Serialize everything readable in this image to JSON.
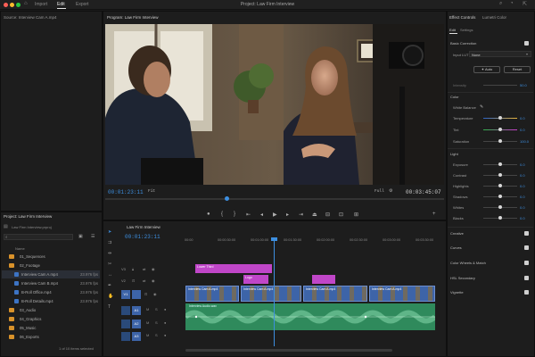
{
  "titlebar": {
    "tabs": [
      "Import",
      "Edit",
      "Export"
    ],
    "active_tab": "Edit",
    "project_title": "Project: Law Firm Interview"
  },
  "source_monitor": {
    "title": "Source: Interview Cam A.mp4"
  },
  "program_monitor": {
    "title": "Program: Law Firm Interview",
    "timecode": "00:01:23:11",
    "fit": "Fit",
    "quality": "Full",
    "duration": "00:03:45:07"
  },
  "effect_controls": {
    "tabs": [
      "Effect Controls",
      "Lumetri Color"
    ],
    "subtabs": [
      "Edit",
      "Settings"
    ],
    "basic_correction": "Basic Correction",
    "input_lut_label": "Input LUT",
    "input_lut_value": "None",
    "auto": "Auto",
    "reset": "Reset",
    "intensity_label": "Intensity",
    "intensity_value": "50.0",
    "color_section": "Color",
    "white_balance": "White Balance",
    "temperature_label": "Temperature",
    "temperature_value": "0.0",
    "tint_label": "Tint",
    "tint_value": "0.0",
    "saturation_label": "Saturation",
    "saturation_value": "100.0",
    "light_section": "Light",
    "light": [
      {
        "label": "Exposure",
        "value": "0.0"
      },
      {
        "label": "Contrast",
        "value": "0.0"
      },
      {
        "label": "Highlights",
        "value": "0.0"
      },
      {
        "label": "Shadows",
        "value": "0.0"
      },
      {
        "label": "Whites",
        "value": "0.0"
      },
      {
        "label": "Blacks",
        "value": "0.0"
      }
    ],
    "sections": [
      "Creative",
      "Curves",
      "Color Wheels & Match",
      "HSL Secondary",
      "Vignette"
    ]
  },
  "project": {
    "title": "Project: Law Firm Interview",
    "file": "Law Firm Interview.prproj",
    "col_name": "Name",
    "items": [
      {
        "name": "01_Sequences",
        "type": "folder",
        "fps": ""
      },
      {
        "name": "02_Footage",
        "type": "folder",
        "fps": ""
      },
      {
        "name": "Interview Cam A.mp4",
        "type": "clip",
        "fps": "23.976 fps"
      },
      {
        "name": "Interview Cam B.mp4",
        "type": "clip",
        "fps": "23.976 fps"
      },
      {
        "name": "B-Roll Office.mp4",
        "type": "clip",
        "fps": "23.976 fps"
      },
      {
        "name": "B-Roll Details.mp4",
        "type": "clip",
        "fps": "23.976 fps"
      },
      {
        "name": "03_Audio",
        "type": "folder",
        "fps": ""
      },
      {
        "name": "04_Graphics",
        "type": "folder",
        "fps": ""
      },
      {
        "name": "05_Music",
        "type": "folder",
        "fps": ""
      },
      {
        "name": "06_Exports",
        "type": "folder",
        "fps": ""
      }
    ],
    "status": "1 of 10 items selected"
  },
  "timeline": {
    "title": "Law Firm Interview",
    "timecode": "00:01:23:11",
    "ruler": [
      "00:00",
      "00:00:30:00",
      "00:01:00:00",
      "00:01:30:00",
      "00:02:00:00",
      "00:02:30:00",
      "00:03:00:00",
      "00:03:30:00"
    ],
    "tracks": [
      "V3",
      "V2",
      "V1",
      "A1",
      "A2",
      "A3"
    ],
    "clips": {
      "v3_title": "Lower Third",
      "v2_logo": "Logo",
      "v1_clips": [
        "Interview Cam A.mp4",
        "Interview Cam A.mp4",
        "Interview Cam A.mp4",
        "Interview Cam A.mp4"
      ],
      "a1_label": "Interview Audio.wav"
    }
  },
  "colors": {
    "accent": "#3d8fe0",
    "video_clip": "#3d64a8",
    "title_clip": "#c046c8",
    "audio_clip": "#2f8a5c"
  }
}
